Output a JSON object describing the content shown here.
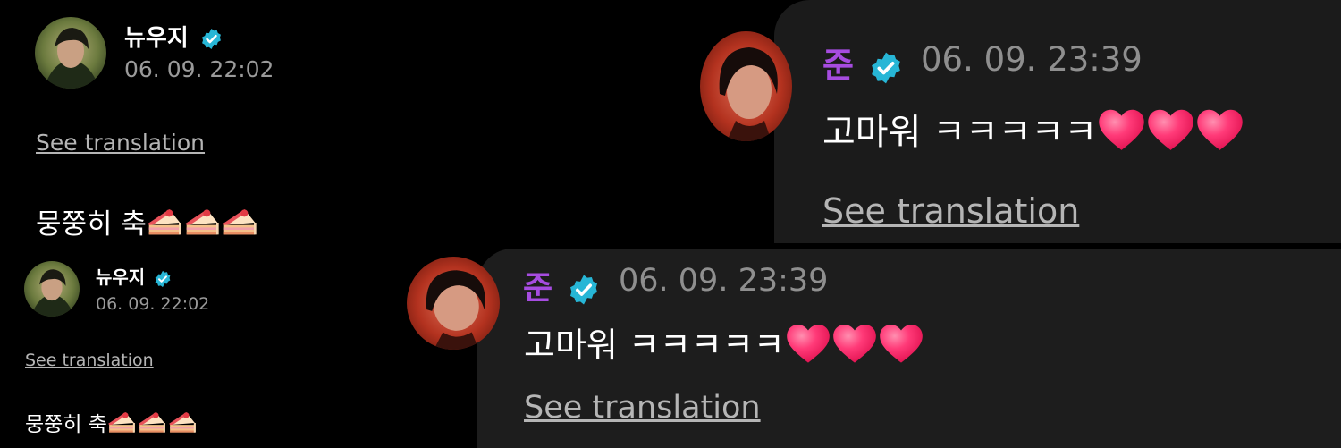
{
  "posts": [
    {
      "author": "뉴우지",
      "time": "06. 09. 22:02",
      "translate_label": "See translation",
      "message": "뭉쭝히 축"
    },
    {
      "author": "준",
      "time": "06. 09. 23:39",
      "translate_label": "See translation",
      "message": "고마워 ㅋㅋㅋㅋㅋ"
    },
    {
      "author": "뉴우지",
      "time": "06. 09. 22:02",
      "translate_label": "See translation",
      "message": "뭉쭝히 축"
    },
    {
      "author": "준",
      "time": "06. 09. 23:39",
      "translate_label": "See translation",
      "message": "고마워 ㅋㅋㅋㅋㅋ"
    }
  ],
  "colors": {
    "background": "#000000",
    "reply_panel": "#1b1b1b",
    "reply_name": "#a64ce0",
    "verified_badge": "#27b6d6",
    "heart": "#ff2d6f"
  },
  "icons": {
    "verified": "verified-badge-icon",
    "heart": "heart-emoji-icon",
    "cake": "cake-slice-emoji-icon"
  }
}
